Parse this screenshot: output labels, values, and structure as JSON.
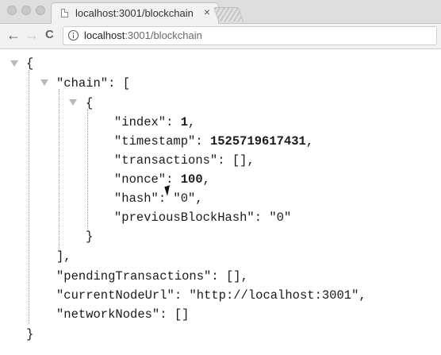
{
  "browser": {
    "tab_title": "localhost:3001/blockchain",
    "tab_close": "×",
    "back": "←",
    "forward": "→",
    "reload": "C",
    "url_host": "localhost",
    "url_path": ":3001/blockchain"
  },
  "json": {
    "open_root": "{",
    "chain_key": "\"chain\"",
    "chain_open": ": [",
    "block_open": "{",
    "index_key": "\"index\"",
    "index_val": "1",
    "timestamp_key": "\"timestamp\"",
    "timestamp_val": "1525719617431",
    "transactions_key": "\"transactions\"",
    "transactions_val": "[]",
    "nonce_key": "\"nonce\"",
    "nonce_val": "100",
    "hash_key": "\"hash\"",
    "hash_val": "\"0\"",
    "previous_key": "\"previousBlockHash\"",
    "previous_val": "\"0\"",
    "block_close": "}",
    "chain_close": "],",
    "pending_key": "\"pendingTransactions\"",
    "pending_val": "[]",
    "current_key": "\"currentNodeUrl\"",
    "current_val": "\"http://localhost:3001\"",
    "nodes_key": "\"networkNodes\"",
    "nodes_val": "[]",
    "close_root": "}"
  },
  "icons": {
    "info": "info-icon",
    "favicon": "page-icon",
    "collapse": "triangle-down-icon"
  }
}
